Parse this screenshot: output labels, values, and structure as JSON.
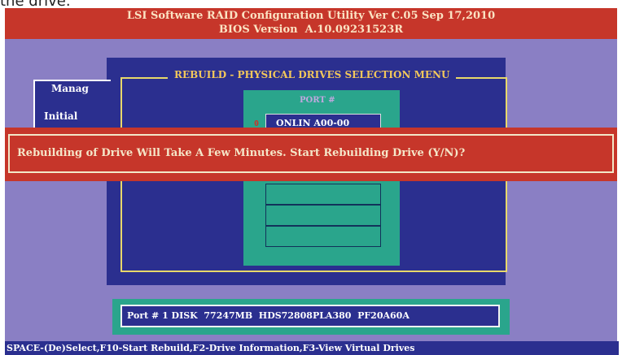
{
  "caption": "the drive.",
  "header": {
    "line1": "LSI Software RAID Configuration Utility Ver C.05 Sep 17,2010",
    "line2": "BIOS Version  A.10.09231523R"
  },
  "left_menu": {
    "title": "Manag",
    "item": "Initial"
  },
  "rebuild_menu": {
    "title": "REBUILD - PHYSICAL DRIVES SELECTION MENU",
    "port_header": "PORT #",
    "selected_index": "0",
    "selected_label": "ONLIN A00-00"
  },
  "alert": {
    "message": "Rebuilding of Drive Will Take A Few Minutes. Start Rebuilding Drive (Y/N)?"
  },
  "drive_info": {
    "text": "Port # 1 DISK  77247MB  HDS72808PLA380  PF20A60A"
  },
  "status_bar": {
    "text": "SPACE-(De)Select,F10-Start Rebuild,F2-Drive Information,F3-View Virtual Drives"
  },
  "colors": {
    "background": "#8a7fc4",
    "title_bar": "#c6362a",
    "panel_blue": "#2b2f8f",
    "panel_teal": "#2aa58c",
    "accent_yellow": "#e8d86a"
  }
}
